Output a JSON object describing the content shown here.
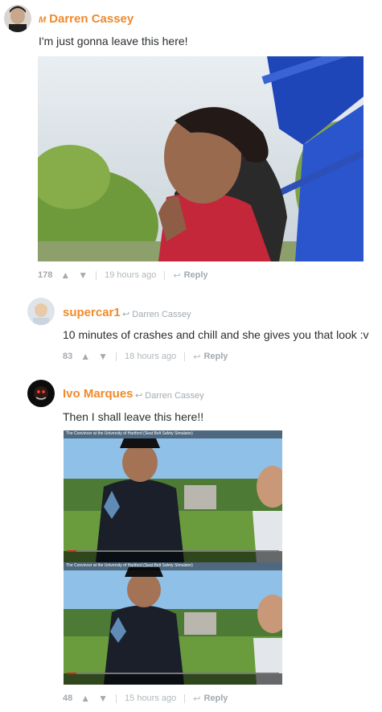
{
  "comments": [
    {
      "author": "Darren Cassey",
      "badge": "M",
      "text": "I'm just gonna leave this here!",
      "votes": "178",
      "time": "19 hours ago",
      "reply": "Reply",
      "upvote_icon": "▲",
      "downvote_icon": "▼"
    },
    {
      "author": "supercar1",
      "reply_to": "Darren Cassey",
      "text": "10 minutes of crashes and chill and she gives you that look :v",
      "votes": "83",
      "time": "18 hours ago",
      "reply": "Reply",
      "upvote_icon": "▲",
      "downvote_icon": "▼"
    },
    {
      "author": "Ivo Marques",
      "reply_to": "Darren Cassey",
      "text": "Then I shall leave this here!!",
      "votes": "48",
      "time": "15 hours ago",
      "reply": "Reply",
      "upvote_icon": "▲",
      "downvote_icon": "▼",
      "video_title": "The Convincer at the University of Hartford (Seat Belt Safety Simulator)"
    }
  ],
  "icons": {
    "reply_arrow": "↩",
    "reply_to_arrow": "↩"
  }
}
